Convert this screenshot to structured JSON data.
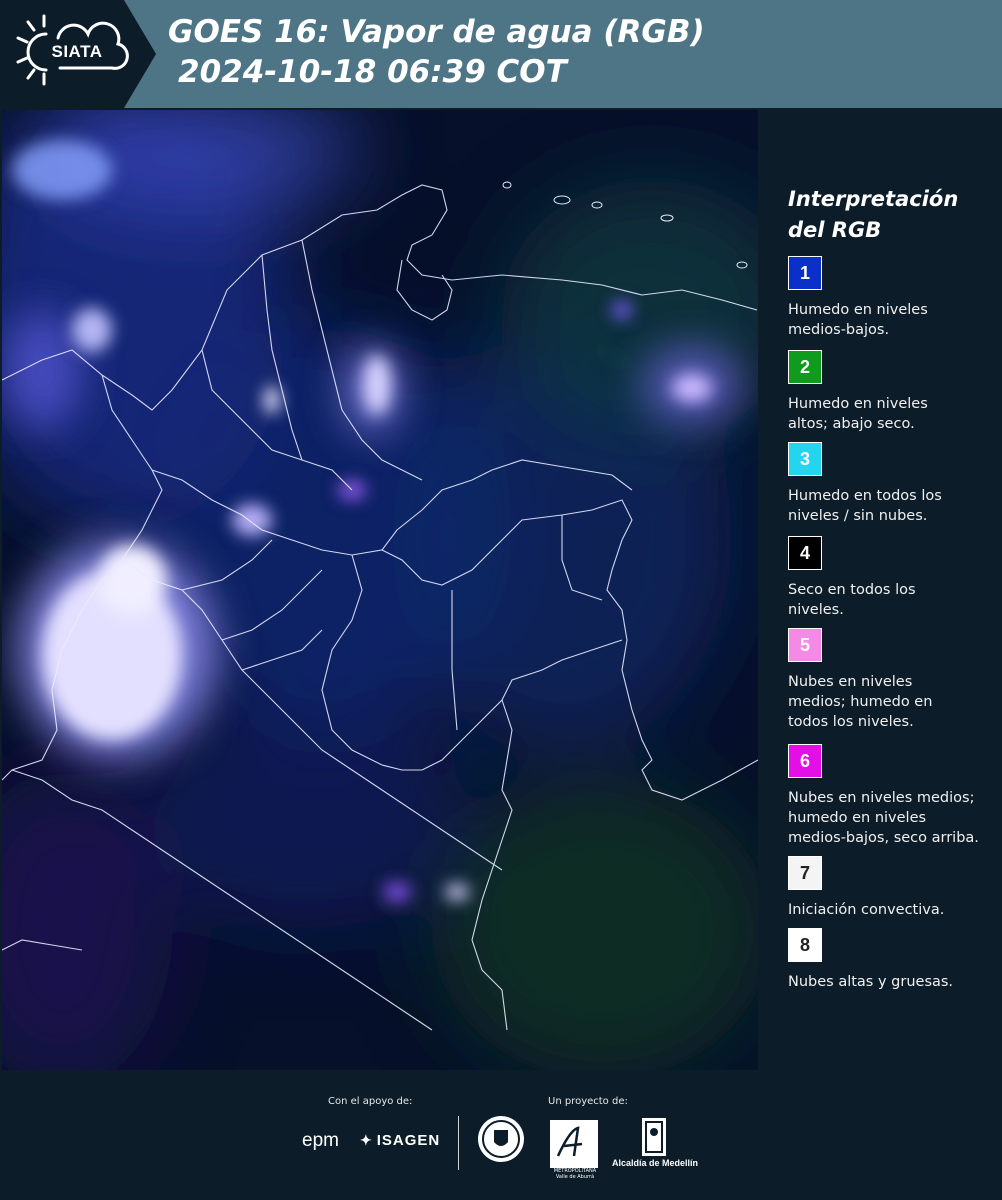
{
  "header": {
    "logo_text": "SIATA",
    "title_line1": "GOES 16: Vapor de agua (RGB)",
    "title_line2": "2024-10-18 06:39 COT"
  },
  "legend": {
    "title_line1": "Interpretación",
    "title_line2": "del RGB",
    "items": [
      {
        "num": "1",
        "color": "#0b2fc9",
        "text_color": "#ffffff",
        "lines": [
          "Humedo en niveles",
          "medios-bajos."
        ]
      },
      {
        "num": "2",
        "color": "#0f9b1c",
        "text_color": "#ffffff",
        "lines": [
          "Humedo en niveles",
          "altos; abajo seco."
        ]
      },
      {
        "num": "3",
        "color": "#25d4ef",
        "text_color": "#ffffff",
        "lines": [
          "Humedo en todos los",
          "niveles / sin nubes."
        ]
      },
      {
        "num": "4",
        "color": "#000000",
        "text_color": "#ffffff",
        "lines": [
          "Seco en todos los",
          "niveles."
        ]
      },
      {
        "num": "5",
        "color": "#f48ae6",
        "text_color": "#ffffff",
        "lines": [
          "Nubes en niveles",
          "medios; humedo en",
          "todos los niveles."
        ]
      },
      {
        "num": "6",
        "color": "#e30fe6",
        "text_color": "#ffffff",
        "lines": [
          "Nubes en niveles medios;",
          "humedo en niveles",
          "medios-bajos, seco arriba."
        ]
      },
      {
        "num": "7",
        "color": "#f4f4f4",
        "text_color": "#222222",
        "lines": [
          "Iniciación convectiva."
        ]
      },
      {
        "num": "8",
        "color": "#ffffff",
        "text_color": "#222222",
        "lines": [
          "Nubes altas y gruesas."
        ]
      }
    ]
  },
  "footer": {
    "support_label": "Con el apoyo de:",
    "project_label": "Un proyecto de:",
    "epm": "epm",
    "isagen": "ISAGEN",
    "area_text": "METROPOLITANA Valle de Aburrá",
    "alcaldia": "Alcaldía de Medellín"
  }
}
